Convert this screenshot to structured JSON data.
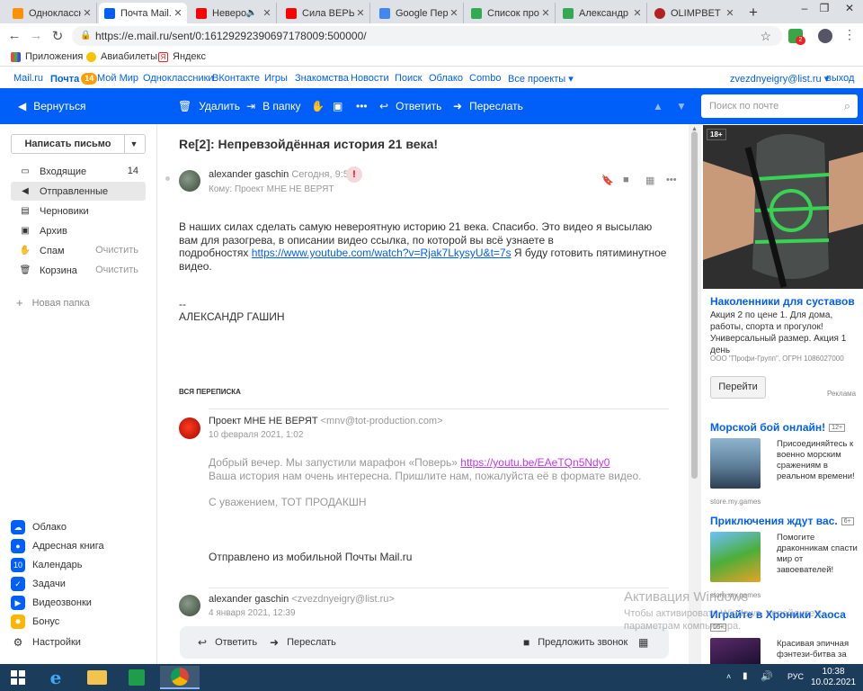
{
  "browser": {
    "tabs": [
      {
        "label": "Одноклассни",
        "color": "#ff9000",
        "active": false
      },
      {
        "label": "Почта Mail.ru",
        "color": "#005ff9",
        "active": true
      },
      {
        "label": "Неверо",
        "color": "#ff0000",
        "active": false
      },
      {
        "label": "Сила ВЕРЫ и",
        "color": "#ff0000",
        "active": false
      },
      {
        "label": "Google Пере",
        "color": "#4285f4",
        "active": false
      },
      {
        "label": "Список про",
        "color": "#34a853",
        "active": false
      },
      {
        "label": "Александр Г",
        "color": "#34a853",
        "active": false
      },
      {
        "label": "OLIMPBET - С",
        "color": "#b22222",
        "active": false
      }
    ],
    "url": "https://e.mail.ru/sent/0:16129292390697178009:500000/",
    "ext_badge": "2",
    "bookmarks": [
      "Приложения",
      "Авиабилеты",
      "Яндекс"
    ]
  },
  "portal": {
    "links": [
      "Mail.ru",
      "Почта",
      "Мой Мир",
      "Одноклассники",
      "ВКонтакте",
      "Игры",
      "Знакомства",
      "Новости",
      "Поиск",
      "Облако",
      "Combo",
      "Все проекты ▾"
    ],
    "mail_badge": "14",
    "account": "zvezdnyeigry@list.ru ▾",
    "logout": "выход"
  },
  "toolbar": {
    "back": "Вернуться",
    "delete": "Удалить",
    "to_folder": "В папку",
    "reply": "Ответить",
    "forward": "Переслать",
    "search_placeholder": "Поиск по почте"
  },
  "sidebar": {
    "compose": "Написать письмо",
    "folders": [
      {
        "icon": "inbox-icon",
        "glyph": "▭",
        "label": "Входящие",
        "count": "14"
      },
      {
        "icon": "sent-icon",
        "glyph": "◀",
        "label": "Отправленные",
        "count": ""
      },
      {
        "icon": "drafts-icon",
        "glyph": "▤",
        "label": "Черновики",
        "count": ""
      },
      {
        "icon": "archive-icon",
        "glyph": "▣",
        "label": "Архив",
        "count": ""
      },
      {
        "icon": "spam-icon",
        "glyph": "✋",
        "label": "Спам",
        "count": "Очистить"
      },
      {
        "icon": "trash-icon",
        "glyph": "🗑",
        "label": "Корзина",
        "count": "Очистить"
      }
    ],
    "new_folder": "Новая папка",
    "services": [
      {
        "icon": "cloud-icon",
        "label": "Облако",
        "color": "#005ff9",
        "glyph": "☁"
      },
      {
        "icon": "addressbook-icon",
        "label": "Адресная книга",
        "color": "#005ff9",
        "glyph": "●"
      },
      {
        "icon": "calendar-icon",
        "label": "Календарь",
        "color": "#005ff9",
        "glyph": "10"
      },
      {
        "icon": "tasks-icon",
        "label": "Задачи",
        "color": "#005ff9",
        "glyph": "✓"
      },
      {
        "icon": "videocall-icon",
        "label": "Видеозвонки",
        "color": "#005ff9",
        "glyph": "▶"
      },
      {
        "icon": "bonus-icon",
        "label": "Бонус",
        "color": "#ffb400",
        "glyph": "✸"
      },
      {
        "icon": "settings-icon",
        "label": "Настройки",
        "color": "#ffffff",
        "glyph": "⚙"
      }
    ]
  },
  "message": {
    "subject": "Re[2]: Непревзойдённая история 21 века!",
    "from": "alexander gaschin",
    "time": "Сегодня, 9:53",
    "to_label": "Кому:",
    "to": "Проект МНЕ НЕ ВЕРЯТ",
    "body_1": "В наших силах сделать самую невероятную историю 21 века. Спасибо. Это видео я высылаю вам для разогрева, в описании видео ссылка, по которой вы всё узнаете в",
    "body_2": "подробностях",
    "link": "https://www.youtube.com/watch?v=Rjak7LkysyU&t=7s",
    "body_3": "Я буду готовить пятиминутное видео.",
    "separator": "--",
    "signature": "АЛЕКСАНДР ГАШИН"
  },
  "thread": {
    "title": "ВСЯ ПЕРЕПИСКА",
    "m1": {
      "from": "Проект МНЕ НЕ ВЕРЯТ",
      "email": "<mnv@tot-production.com>",
      "date": "10 февраля 2021, 1:02",
      "text_1": "Добрый вечер. Мы запустили марафон «Поверь»",
      "link": "https://youtu.be/EAeTQn5Ndy0",
      "text_2": "Ваша история нам очень интересна. Пришлите нам, пожалуйста её в формате видео.",
      "regards": "С уважением, ТОТ ПРОДАКШН",
      "footer": "Отправлено из мобильной Почты Mail.ru"
    },
    "m2": {
      "from": "alexander gaschin",
      "email": "<zvezdnyeigry@list.ru>",
      "date": "4 января 2021, 12:39"
    }
  },
  "bottombar": {
    "reply": "Ответить",
    "forward": "Переслать",
    "video": "Предложить звонок"
  },
  "ads": {
    "age": "18+",
    "a1_title": "Наколенники для суставов",
    "a1_text": "Акция 2 по цене 1. Для дома, работы, спорта и прогулок! Универсальный размер. Акция 1 день",
    "a1_legal": "ООО \"Профи-Групп\", ОГРН 1086027000",
    "a1_button": "Перейти",
    "a1_label": "Реклама",
    "a2_title": "Морской бой онлайн!",
    "a2_age": "12+",
    "a2_text": "Присоединяйтесь к военно морским сражениям в реальном времени!",
    "a2_src": "store.my.games",
    "a3_title": "Приключения ждут вас.",
    "a3_age": "6+",
    "a3_text": "Помогите драконникам спасти мир от завоевателей!",
    "a3_src": "store.my.games",
    "a4_title": "Играйте в Хроники Хаоса",
    "a4_age": "16+",
    "a4_text": "Красивая эпичная фэнтези-битва за"
  },
  "watermark": {
    "title": "Активация Windows",
    "line1": "Чтобы активировать Windows, перейдите к",
    "line2": "параметрам компьютера."
  },
  "taskbar": {
    "lang": "РУС",
    "time": "10:38",
    "date": "10.02.2021"
  }
}
